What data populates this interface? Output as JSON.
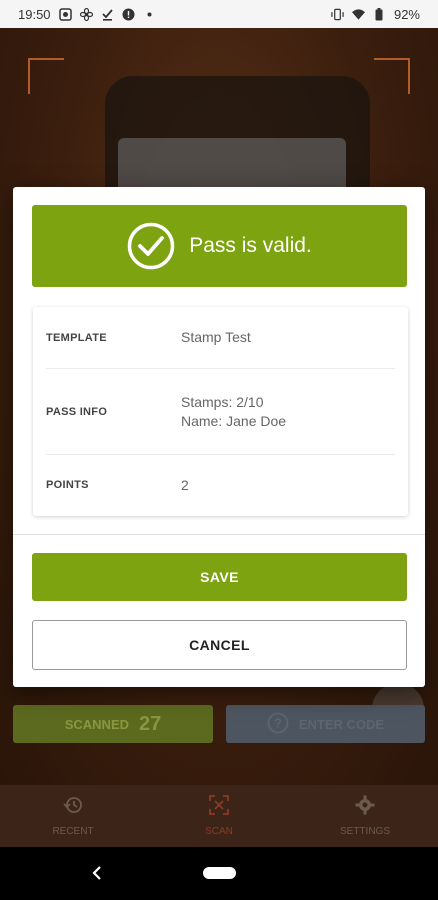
{
  "status_bar": {
    "time": "19:50",
    "battery": "92%",
    "left_icons": [
      "photo-icon",
      "fan-icon",
      "download-done-icon",
      "alert-icon",
      "dot-icon"
    ],
    "right_icons": [
      "vibrate-icon",
      "wifi-icon",
      "battery-icon"
    ]
  },
  "dialog": {
    "status_message": "Pass is valid.",
    "rows": [
      {
        "key": "TEMPLATE",
        "value": "Stamp Test"
      },
      {
        "key": "PASS INFO",
        "value_lines": [
          "Stamps: 2/10",
          "Name: Jane Doe"
        ]
      },
      {
        "key": "POINTS",
        "value": "2"
      }
    ],
    "save_label": "SAVE",
    "cancel_label": "CANCEL"
  },
  "actions": {
    "scanned_label": "SCANNED",
    "scanned_count": "27",
    "enter_code_label": "ENTER CODE"
  },
  "bottom_nav": [
    {
      "label": "RECENT",
      "icon": "history-icon",
      "active": false
    },
    {
      "label": "SCAN",
      "icon": "scan-icon",
      "active": true
    },
    {
      "label": "SETTINGS",
      "icon": "gear-icon",
      "active": false
    }
  ],
  "colors": {
    "accent_green": "#7ea310",
    "scan_active": "#8a3a25"
  }
}
